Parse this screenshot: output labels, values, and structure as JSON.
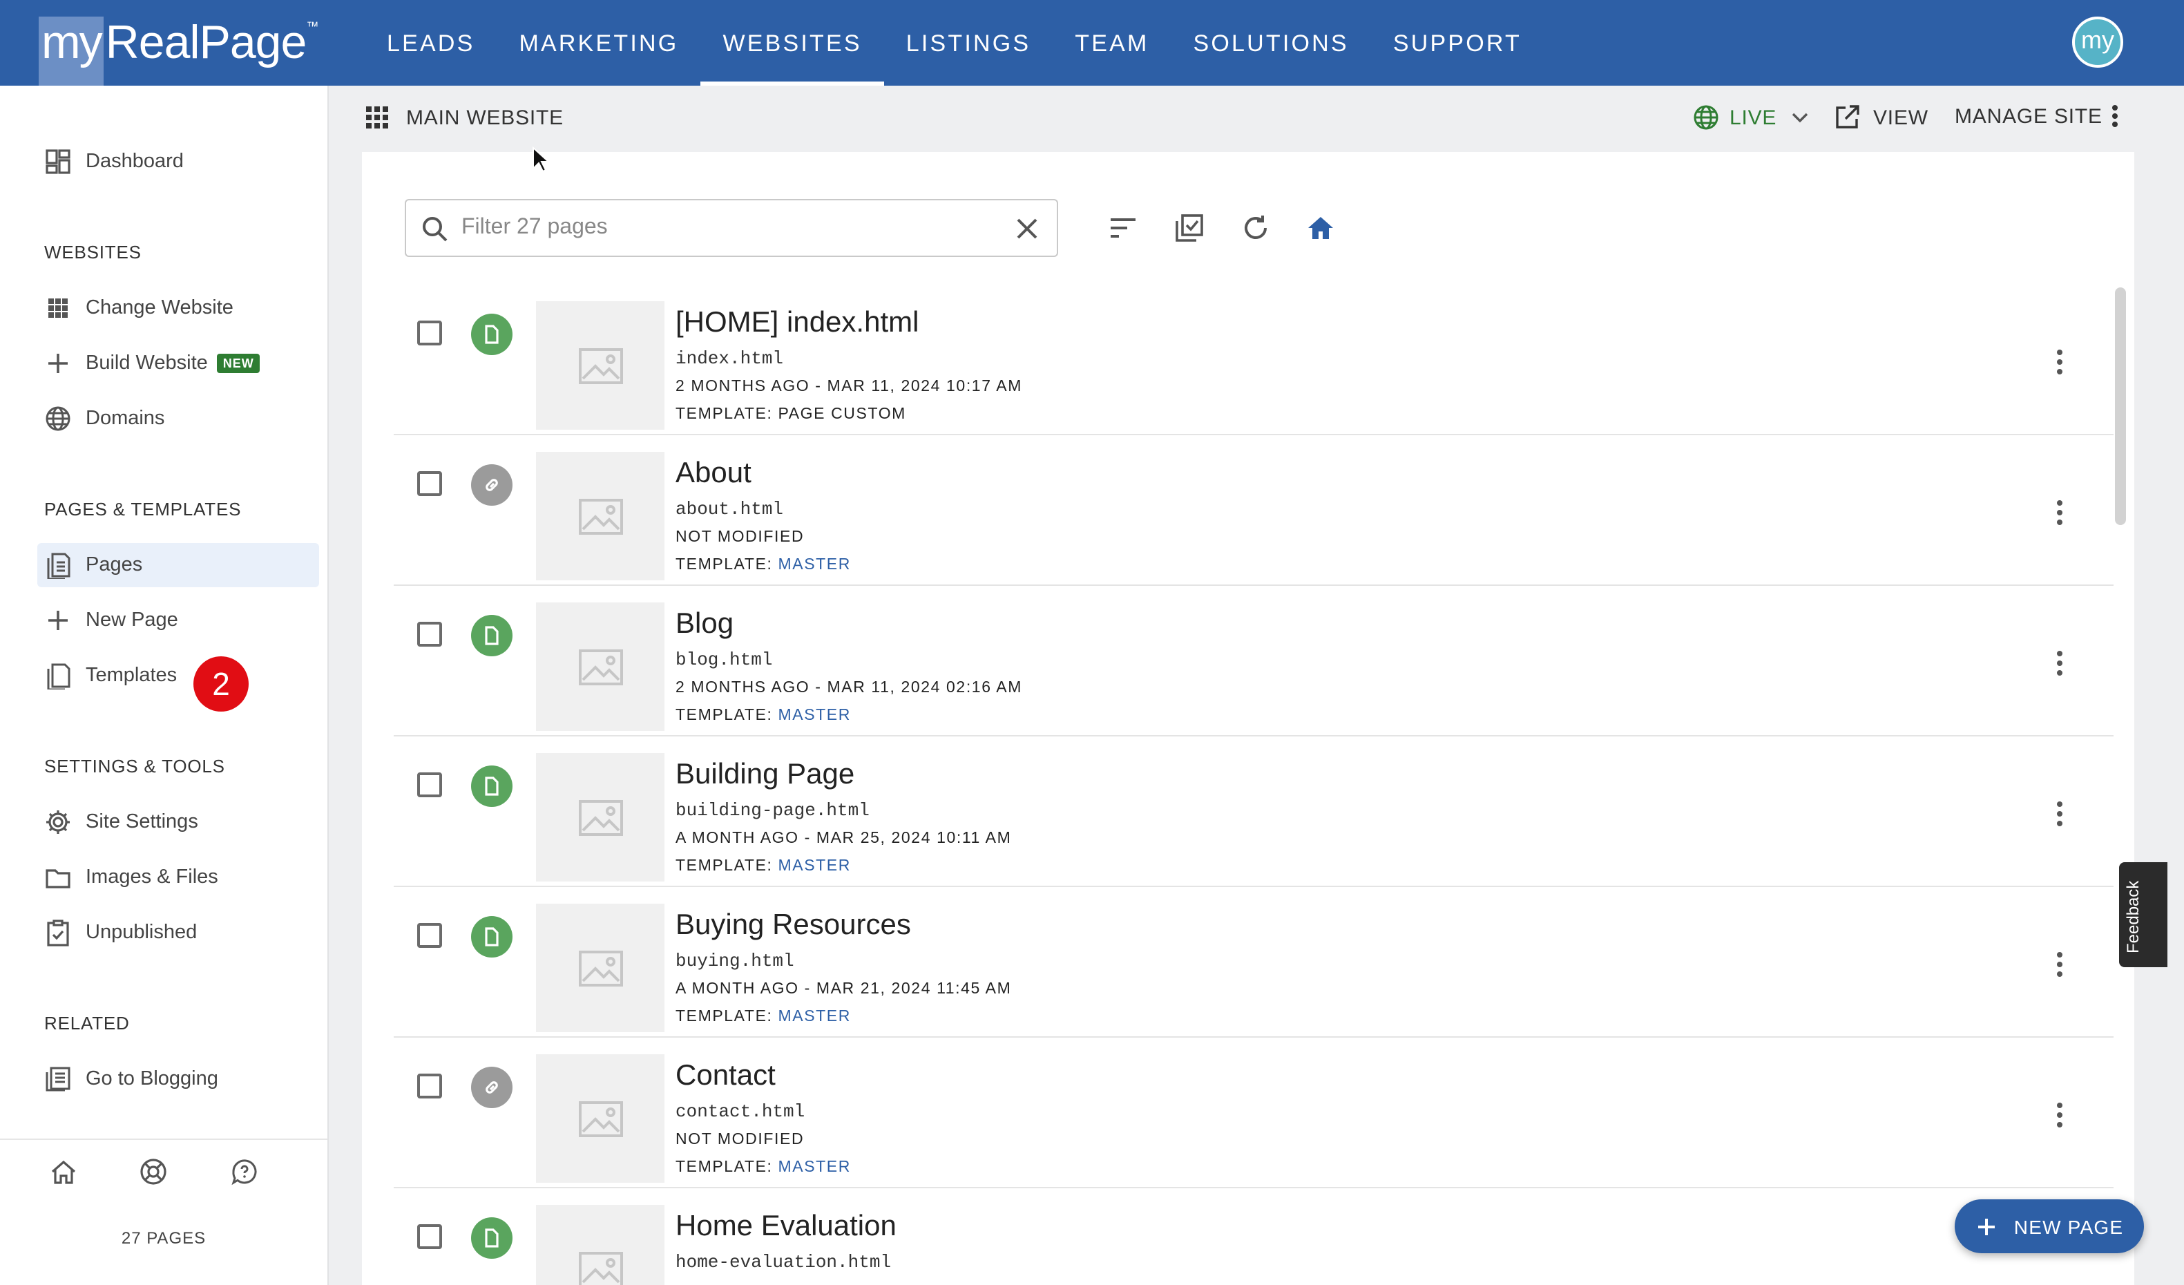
{
  "brand": {
    "logo_my": "my",
    "logo_name": "RealPage",
    "logo_tm": "™",
    "avatar": "my"
  },
  "nav": [
    "LEADS",
    "MARKETING",
    "WEBSITES",
    "LISTINGS",
    "TEAM",
    "SOLUTIONS",
    "SUPPORT"
  ],
  "nav_active": "WEBSITES",
  "sidebar": {
    "dashboard": "Dashboard",
    "websites_heading": "WEBSITES",
    "change_website": "Change Website",
    "build_website": "Build Website",
    "build_badge": "NEW",
    "domains": "Domains",
    "pages_heading": "PAGES & TEMPLATES",
    "pages": "Pages",
    "new_page": "New Page",
    "templates": "Templates",
    "templates_badge": "2",
    "settings_heading": "SETTINGS & TOOLS",
    "site_settings": "Site Settings",
    "images_files": "Images & Files",
    "unpublished": "Unpublished",
    "related_heading": "RELATED",
    "go_blogging": "Go to Blogging",
    "page_count": "27 PAGES"
  },
  "subheader": {
    "title": "MAIN WEBSITE",
    "live": "LIVE",
    "view": "VIEW",
    "manage": "MANAGE SITE"
  },
  "search": {
    "placeholder": "Filter 27 pages",
    "value": ""
  },
  "template_label": "TEMPLATE:",
  "pages": [
    {
      "name": "[HOME] index.html",
      "file": "index.html",
      "modified": "2 MONTHS AGO - MAR 11, 2024 10:17 AM",
      "template": "PAGE CUSTOM",
      "type": "page"
    },
    {
      "name": "About",
      "file": "about.html",
      "modified": "NOT MODIFIED",
      "template": "MASTER",
      "type": "link"
    },
    {
      "name": "Blog",
      "file": "blog.html",
      "modified": "2 MONTHS AGO - MAR 11, 2024 02:16 AM",
      "template": "MASTER",
      "type": "page"
    },
    {
      "name": "Building Page",
      "file": "building-page.html",
      "modified": "A MONTH AGO - MAR 25, 2024 10:11 AM",
      "template": "MASTER",
      "type": "page"
    },
    {
      "name": "Buying Resources",
      "file": "buying.html",
      "modified": "A MONTH AGO - MAR 21, 2024 11:45 AM",
      "template": "MASTER",
      "type": "page"
    },
    {
      "name": "Contact",
      "file": "contact.html",
      "modified": "NOT MODIFIED",
      "template": "MASTER",
      "type": "link"
    },
    {
      "name": "Home Evaluation",
      "file": "home-evaluation.html",
      "modified": "",
      "template": "",
      "type": "page"
    }
  ],
  "feedback": "Feedback",
  "fab": "NEW PAGE",
  "colors": {
    "brand": "#2d5fa6",
    "live": "#2e7d32",
    "badge": "#e10d14",
    "page_status": "#5aa55e"
  }
}
